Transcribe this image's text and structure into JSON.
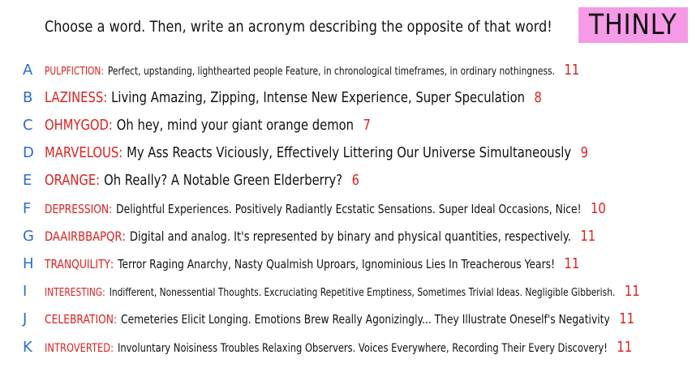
{
  "prompt": "Choose a word. Then, write an acronym describing the opposite of that word!",
  "badge": "THINLY",
  "rows": [
    {
      "letter": "A",
      "word": "PULPFICTION",
      "phrase": "Perfect, upstanding, lighthearted people Feature, in chronological timeframes, in ordinary nothingness.",
      "count": "11"
    },
    {
      "letter": "B",
      "word": "LAZINESS",
      "phrase": "Living Amazing, Zipping, Intense New Experience, Super Speculation",
      "count": "8"
    },
    {
      "letter": "C",
      "word": "OHMYGOD",
      "phrase": "Oh hey, mind your giant orange demon",
      "count": "7"
    },
    {
      "letter": "D",
      "word": "MARVELOUS",
      "phrase": "My Ass Reacts Viciously, Effectively Littering Our Universe Simultaneously",
      "count": "9"
    },
    {
      "letter": "E",
      "word": "ORANGE",
      "phrase": "Oh Really? A Notable Green Elderberry?",
      "count": "6"
    },
    {
      "letter": "F",
      "word": "DEPRESSION",
      "phrase": "Delightful Experiences. Positively Radiantly Ecstatic Sensations. Super Ideal Occasions, Nice!",
      "count": "10"
    },
    {
      "letter": "G",
      "word": "DAAIRBBAPQR",
      "phrase": "Digital and analog. It's represented by binary and physical quantities, respectively.",
      "count": "11"
    },
    {
      "letter": "H",
      "word": "TRANQUILITY",
      "phrase": "Terror Raging Anarchy, Nasty Qualmish Uproars, Ignominious Lies In Treacherous Years!",
      "count": "11"
    },
    {
      "letter": "I",
      "word": "INTERESTING",
      "phrase": "Indifferent, Nonessential Thoughts. Excruciating Repetitive Emptiness, Sometimes Trivial Ideas. Negligible Gibberish.",
      "count": "11"
    },
    {
      "letter": "J",
      "word": "CELEBRATION",
      "phrase": "Cemeteries Elicit Longing. Emotions Brew Really Agonizingly... They Illustrate Oneself's Negativity",
      "count": "11"
    },
    {
      "letter": "K",
      "word": "INTROVERTED",
      "phrase": "Involuntary Noisiness Troubles Relaxing Observers. Voices Everywhere, Recording Their Every Discovery!",
      "count": "11"
    }
  ]
}
